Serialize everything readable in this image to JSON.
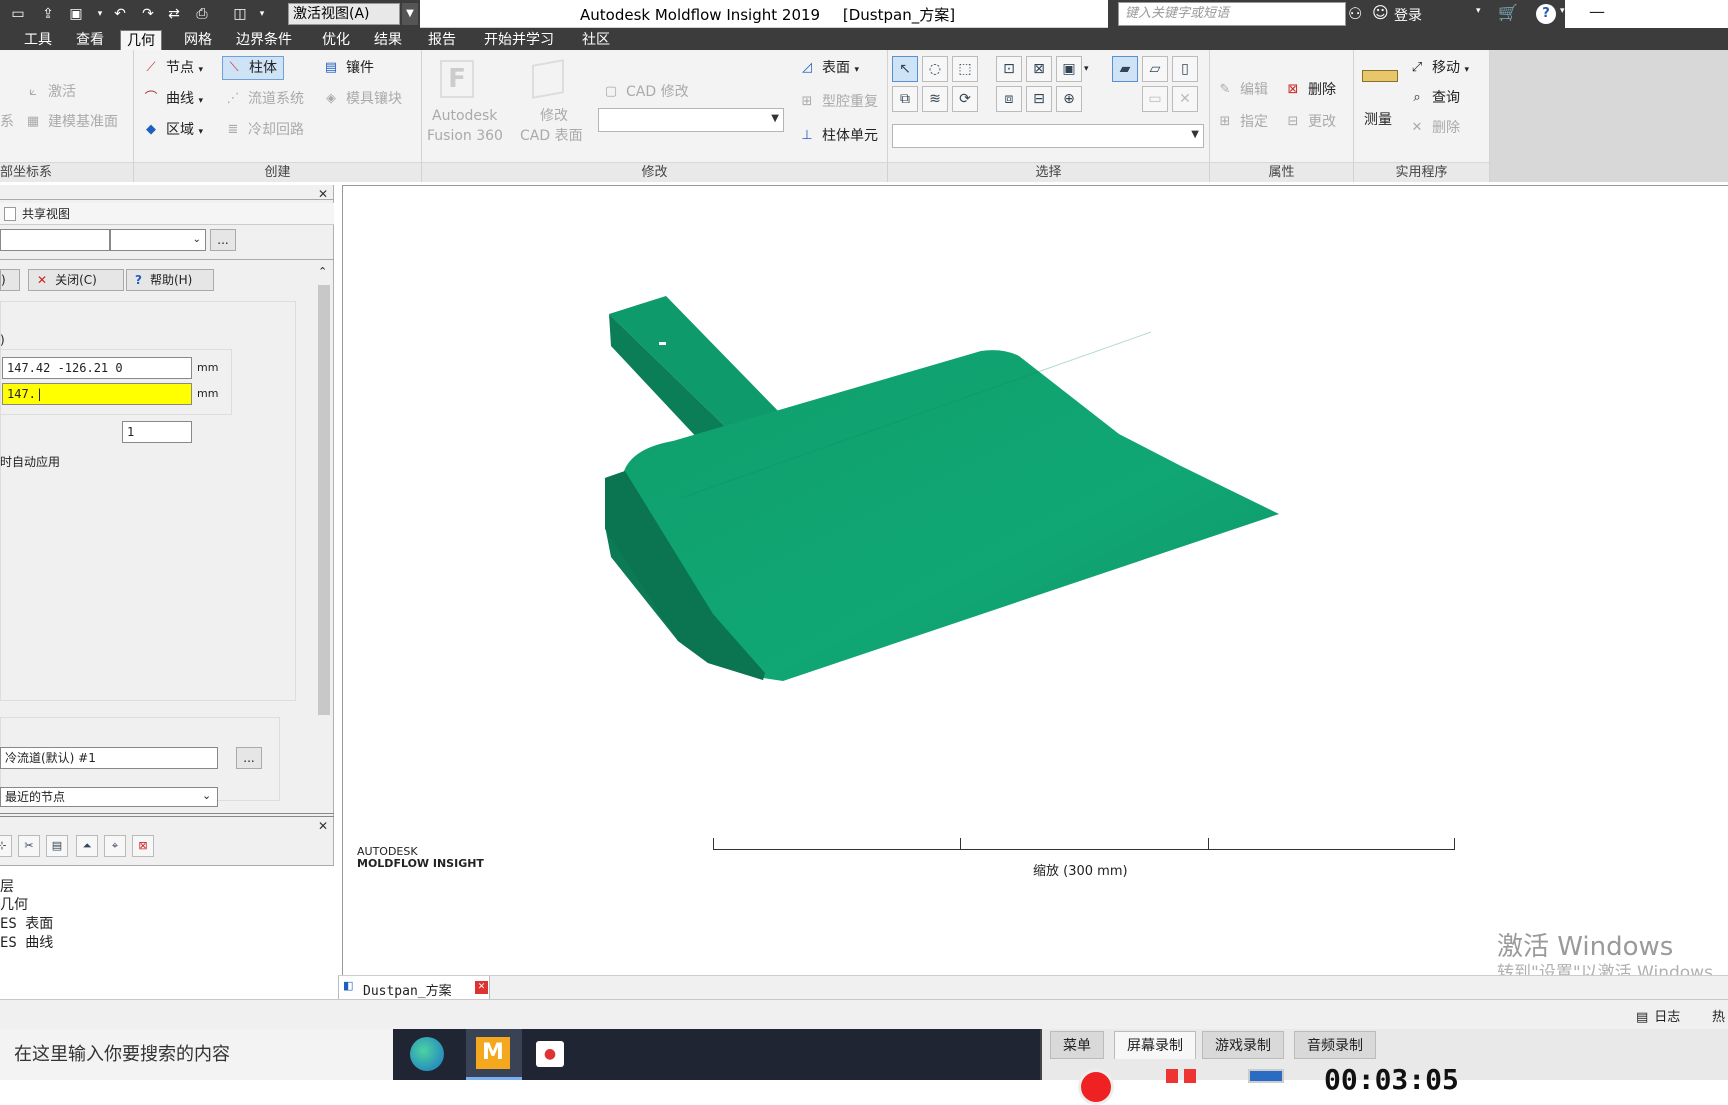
{
  "titlebar": {
    "workspace": "激活视图(A)",
    "app_title": "Autodesk Moldflow Insight 2019",
    "project": "[Dustpan_方案]",
    "search_placeholder": "键入关键字或短语",
    "login": "登录"
  },
  "menu": {
    "tabs": [
      "工具",
      "查看",
      "几何",
      "网格",
      "边界条件",
      "优化",
      "结果",
      "报告",
      "开始并学习",
      "社区"
    ],
    "active": "几何"
  },
  "ribbon": {
    "coord_group": {
      "label": "部坐标系",
      "activate": "激活",
      "model_plane": "建模基准面",
      "sys": "系"
    },
    "create_group": {
      "label": "创建",
      "node": "节点",
      "curve": "曲线",
      "region": "区域",
      "column": "柱体",
      "runner": "流道系统",
      "cooling": "冷却回路",
      "insert": "镶件",
      "mold_insert": "模具镶块"
    },
    "modify_group": {
      "label": "修改",
      "fusion": "Autodesk",
      "fusion2": "Fusion 360",
      "modify_cad": "修改",
      "modify_cad2": "CAD 表面",
      "cad_modify": "CAD 修改",
      "surface": "表面",
      "cavity_dup": "型腔重复",
      "column_unit": "柱体单元"
    },
    "select_group": {
      "label": "选择"
    },
    "props_group": {
      "label": "属性",
      "edit": "编辑",
      "delete": "删除",
      "assign": "指定",
      "change": "更改"
    },
    "utility_group": {
      "label": "实用程序",
      "measure": "测量",
      "move": "移动",
      "query": "查询",
      "delete": "删除"
    }
  },
  "left_panel": {
    "shared_view": "共享视图",
    "close_btn": "关闭(C)",
    "help_btn": "帮助(H)",
    "coord1": "147.42 -126.21 0",
    "coord2": "147.|",
    "unit1": "mm",
    "unit2": "mm",
    "count": "1",
    "auto_apply": "时自动应用",
    "channel": "冷流道(默认) #1",
    "recent_nodes": "最近的节点",
    "ellipsis": "...",
    "layers": [
      "层",
      "几何",
      "ES 表面",
      "ES 曲线"
    ]
  },
  "viewport": {
    "brand1": "AUTODESK",
    "brand2": "MOLDFLOW INSIGHT",
    "scale_label": "缩放 (300 mm)"
  },
  "doc_tab": "Dustpan_方案",
  "statusbar": {
    "log": "日志",
    "hot": "热"
  },
  "watermark": {
    "line1": "激活 Windows",
    "line2": "转到\"设置\"以激活 Windows"
  },
  "taskbar": {
    "search": "在这里输入你要搜索的内容",
    "rec_tabs": [
      "菜单",
      "屏幕录制",
      "游戏录制",
      "音频录制"
    ],
    "rec_active": "屏幕录制",
    "timer": "00:03:05"
  },
  "colors": {
    "model": "#0e9a6b",
    "accent": "#0078d7"
  }
}
